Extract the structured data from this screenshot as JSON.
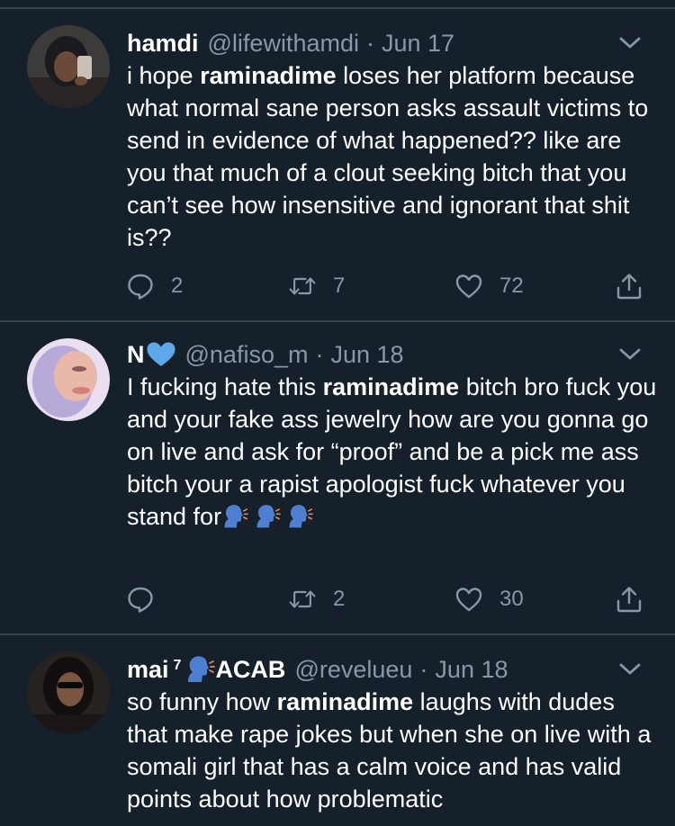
{
  "tweets": [
    {
      "name": "hamdi",
      "handle": "@lifewithamdi",
      "separator": "·",
      "date": "Jun 17",
      "body": [
        {
          "t": "i hope "
        },
        {
          "t": "raminadime",
          "b": true
        },
        {
          "t": " loses her platform because what normal sane person asks assault victims to send in evidence of what happened?? like are you that much of a clout seeking bitch that you can’t see how insensitive and ignorant that shit is??"
        }
      ],
      "replies": "2",
      "retweets": "7",
      "likes": "72"
    },
    {
      "name": "N",
      "handle": "@nafiso_m",
      "separator": "·",
      "date": "Jun 18",
      "body": [
        {
          "t": "I fucking hate this "
        },
        {
          "t": "raminadime",
          "b": true
        },
        {
          "t": " bitch bro fuck you and your fake ass jewelry how are you gonna go on live and ask for “proof” and be a pick me ass bitch your a rapist apologist fuck whatever you stand for"
        }
      ],
      "replies": "",
      "retweets": "2",
      "likes": "30"
    },
    {
      "name": "mai",
      "name_sup": "7",
      "name_suffix": "ACAB",
      "handle": "@revelueu",
      "separator": "·",
      "date": "Jun 18",
      "body": [
        {
          "t": "so funny how "
        },
        {
          "t": "raminadime",
          "b": true
        },
        {
          "t": " laughs with dudes that make rape jokes but when she on live with a somali girl that has a calm voice and has valid points about how problematic"
        }
      ]
    }
  ],
  "icons": {
    "reply": "reply-icon",
    "retweet": "retweet-icon",
    "like": "heart-icon",
    "share": "share-icon",
    "more": "chevron-down-icon",
    "emoji": "speaking-head-emoji",
    "name_heart": "blue-heart-emoji"
  },
  "colors": {
    "background": "#15202b",
    "separator": "#38444d",
    "secondary_text": "#8899a6",
    "heart_blue": "#5da8e8"
  }
}
